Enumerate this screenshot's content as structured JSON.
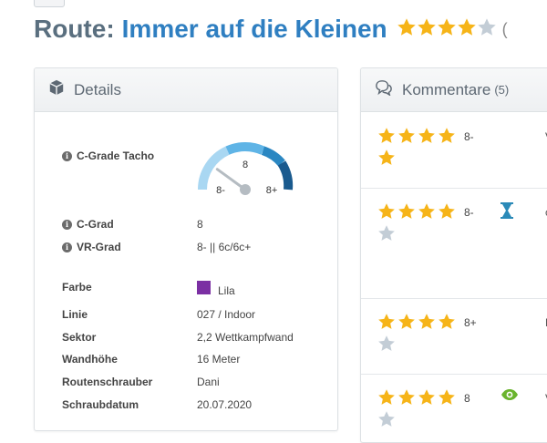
{
  "route": {
    "title_prefix": "Route:",
    "name": "Immer auf die Kleinen",
    "stars": [
      1,
      1,
      1,
      1,
      0
    ],
    "extra": "("
  },
  "details": {
    "header": "Details",
    "tacho": {
      "label": "C-Grade Tacho",
      "center": "8",
      "low": "8-",
      "high": "8+",
      "value_fraction": 0.2
    },
    "rows": [
      {
        "label": "C-Grad",
        "value": "8",
        "info": true
      },
      {
        "label": "VR-Grad",
        "value": "8- || 6c/6c+",
        "info": true
      },
      {
        "label": "Farbe",
        "value": "Lila",
        "swatch": "#7b2fa3"
      },
      {
        "label": "Linie",
        "value": "027 / Indoor"
      },
      {
        "label": "Sektor",
        "value": "2,2 Wettkampfwand"
      },
      {
        "label": "Wandhöhe",
        "value": "16 Meter"
      },
      {
        "label": "Routenschrauber",
        "value": "Dani"
      },
      {
        "label": "Schraubdatum",
        "value": "20.07.2020"
      }
    ]
  },
  "comments": {
    "header": "Kommentare",
    "count": "(5)",
    "items": [
      {
        "stars": [
          1,
          1,
          1,
          1,
          1
        ],
        "grade": "8-",
        "icon": "",
        "right": "V"
      },
      {
        "stars": [
          1,
          1,
          1,
          1,
          0
        ],
        "grade": "8-",
        "icon": "hourglass-icon",
        "right": "c"
      },
      {
        "stars": [
          1,
          1,
          1,
          1,
          0
        ],
        "grade": "8+",
        "icon": "",
        "right": "E"
      },
      {
        "stars": [
          1,
          1,
          1,
          1,
          0
        ],
        "grade": "8",
        "icon": "eye-icon",
        "right": "V"
      }
    ]
  },
  "colors": {
    "star_on": "#f6b418",
    "star_off": "#c3cdd6",
    "title_prefix": "#5a6f7f",
    "title_name": "#2f7fc1",
    "hourglass": "#2b8ab8",
    "eye": "#6ab42d"
  }
}
